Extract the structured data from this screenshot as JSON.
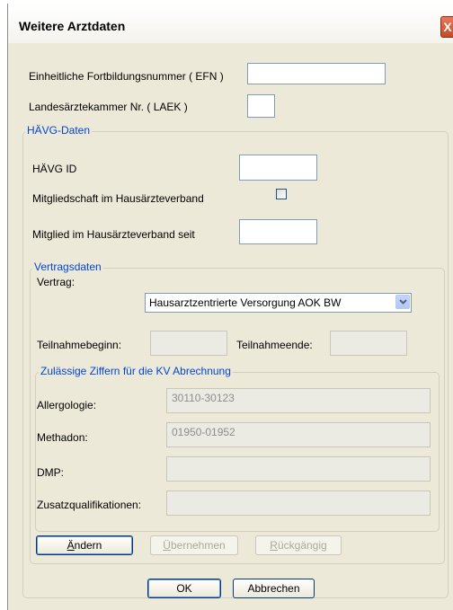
{
  "window": {
    "title": "Weitere Arztdaten",
    "close_glyph": "X"
  },
  "fields": {
    "efn_label": "Einheitliche Fortbildungsnummer ( EFN )",
    "efn_value": "",
    "laek_label": "Landesärztekammer Nr. ( LAEK )",
    "laek_value": ""
  },
  "haevg": {
    "legend": "HÄVG-Daten",
    "id_label": "HÄVG ID",
    "id_value": "",
    "membership_label": "Mitgliedschaft im Hausärzteverband",
    "membership_checked": false,
    "member_since_label": "Mitglied im Hausärzteverband seit",
    "member_since_value": ""
  },
  "vertragsdaten": {
    "legend": "Vertragsdaten",
    "vertrag_label": "Vertrag:",
    "vertrag_value": "Hausarztzentrierte Versorgung AOK BW",
    "teilnahmebeginn_label": "Teilnahmebeginn:",
    "teilnahmebeginn_value": "",
    "teilnahmeende_label": "Teilnahmeende:",
    "teilnahmeende_value": ""
  },
  "ziffern": {
    "legend": "Zulässige Ziffern für die KV Abrechnung",
    "allergologie_label": "Allergologie:",
    "allergologie_value": "30110-30123",
    "methadon_label": "Methadon:",
    "methadon_value": "01950-01952",
    "dmp_label": "DMP:",
    "dmp_value": "",
    "zusatz_label": "Zusatzqualifikationen:",
    "zusatz_value": ""
  },
  "buttons": {
    "aendern_first": "Ä",
    "aendern_rest": "ndern",
    "uebernehmen_first": "Ü",
    "uebernehmen_rest": "bernehmen",
    "rueckgaengig_first": "R",
    "rueckgaengig_rest": "ückgängig",
    "ok": "OK",
    "abbrechen": "Abbrechen"
  },
  "icons": {
    "close": "close-icon",
    "dropdown": "chevron-down-icon"
  }
}
